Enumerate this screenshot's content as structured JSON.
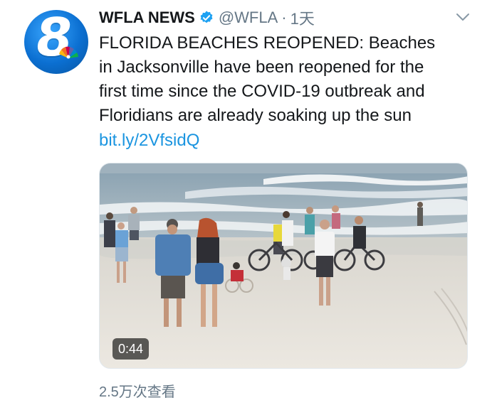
{
  "tweet": {
    "avatar_icon": "wfla-channel-8-logo",
    "display_name": "WFLA NEWS",
    "verified_icon": "verified-badge-icon",
    "handle": "@WFLA",
    "separator": "·",
    "timestamp": "1天",
    "menu_icon": "chevron-down-icon",
    "text_lines": [
      "FLORIDA BEACHES REOPENED: Beaches",
      "in Jacksonville have been reopened for the",
      "first time since the COVID-19 outbreak and",
      "Floridians are already soaking up the sun"
    ],
    "link": "bit.ly/2VfsidQ",
    "video": {
      "duration": "0:44"
    },
    "views": "2.5万次查看"
  },
  "colors": {
    "link": "#1b95e0",
    "secondary_text": "#657786",
    "verified": "#1da1f2"
  }
}
